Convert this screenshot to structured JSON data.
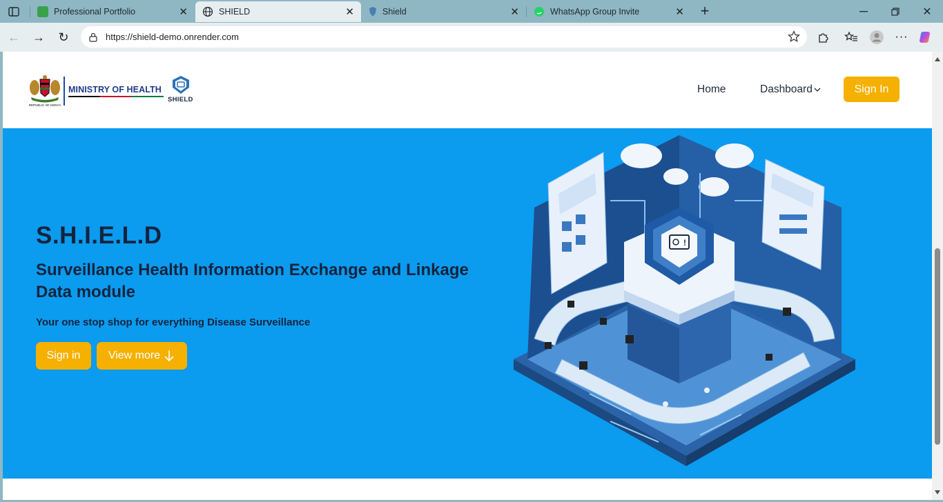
{
  "browser": {
    "tabs": [
      {
        "title": "Professional Portfolio",
        "favicon": "portfolio-icon",
        "active": false
      },
      {
        "title": "SHIELD",
        "favicon": "globe-icon",
        "active": true
      },
      {
        "title": "Shield",
        "favicon": "shield-icon",
        "active": false
      },
      {
        "title": "WhatsApp Group Invite",
        "favicon": "whatsapp-icon",
        "active": false
      }
    ],
    "url": "https://shield-demo.onrender.com"
  },
  "header": {
    "ministry": "MINISTRY OF HEALTH",
    "coa_caption": "REPUBLIC OF KENYA",
    "logo_text": "SHIELD",
    "nav": {
      "home": "Home",
      "dashboard": "Dashboard"
    },
    "signin": "Sign In"
  },
  "hero": {
    "title": "S.H.I.E.L.D",
    "subtitle": "Surveillance Health Information Exchange and Linkage Data module",
    "tagline": "Your one stop shop for everything Disease Surveillance",
    "signin": "Sign in",
    "view_more": "View more"
  },
  "colors": {
    "accent": "#f5b000",
    "hero_bg": "#0b9bef",
    "text_dark": "#14243e",
    "brand_blue": "#1e3a8a"
  }
}
